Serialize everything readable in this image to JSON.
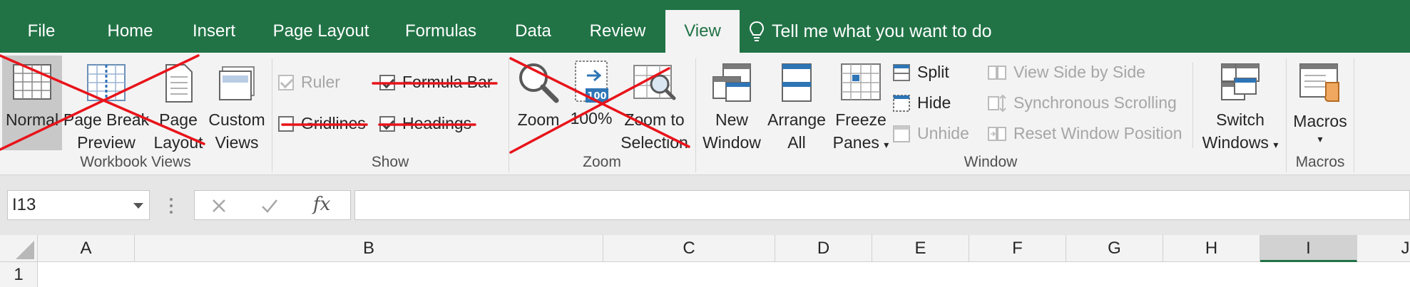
{
  "tabs": [
    {
      "label": "File"
    },
    {
      "label": "Home"
    },
    {
      "label": "Insert"
    },
    {
      "label": "Page Layout"
    },
    {
      "label": "Formulas"
    },
    {
      "label": "Data"
    },
    {
      "label": "Review"
    },
    {
      "label": "View",
      "active": true
    }
  ],
  "tell_me": "Tell me what you want to do",
  "workbook_views": {
    "group_label": "Workbook Views",
    "normal": "Normal",
    "page_break_1": "Page Break",
    "page_break_2": "Preview",
    "page_layout_1": "Page",
    "page_layout_2": "Layout",
    "custom_1": "Custom",
    "custom_2": "Views"
  },
  "show": {
    "group_label": "Show",
    "ruler": "Ruler",
    "gridlines": "Gridlines",
    "formula_bar": "Formula Bar",
    "headings": "Headings"
  },
  "zoom": {
    "group_label": "Zoom",
    "zoom": "Zoom",
    "hundred": "100%",
    "zoom_sel_1": "Zoom to",
    "zoom_sel_2": "Selection",
    "badge": "100"
  },
  "window": {
    "group_label": "Window",
    "new_1": "New",
    "new_2": "Window",
    "arrange_1": "Arrange",
    "arrange_2": "All",
    "freeze_1": "Freeze",
    "freeze_2": "Panes",
    "split": "Split",
    "hide": "Hide",
    "unhide": "Unhide",
    "side_by_side": "View Side by Side",
    "sync_scroll": "Synchronous Scrolling",
    "reset_pos": "Reset Window Position",
    "switch_1": "Switch",
    "switch_2": "Windows"
  },
  "macros": {
    "group_label": "Macros",
    "label": "Macros"
  },
  "formula_bar": {
    "name_box": "I13",
    "fx": "fx",
    "value": ""
  },
  "columns": [
    "A",
    "B",
    "C",
    "D",
    "E",
    "F",
    "G",
    "H",
    "I",
    "J"
  ],
  "selected_column": "I",
  "rows": [
    "1"
  ],
  "colors": {
    "accent": "#217346",
    "strike": "#e8141b"
  }
}
